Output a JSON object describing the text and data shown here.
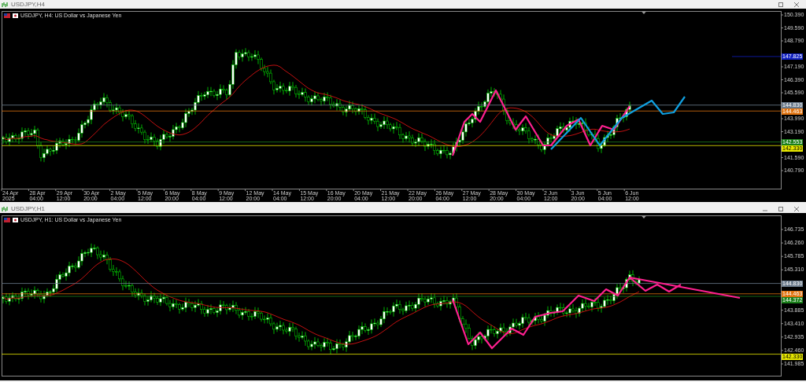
{
  "windows": [
    {
      "title": "USDJPY,H4",
      "header": "USDJPY, H4: US Dollar vs Japanese Yen",
      "price_labels": [
        "150.390",
        "149.590",
        "148.790",
        "147.190",
        "146.390",
        "145.590",
        "143.990",
        "143.190",
        "141.590",
        "140.790"
      ],
      "level_labels": [
        {
          "text": "147.825",
          "color": "#1020c0"
        },
        {
          "text": "144.830",
          "color": "#6b7b8c"
        },
        {
          "text": "144.463",
          "color": "#e0720e"
        },
        {
          "text": "142.553",
          "color": "#1a7f1a"
        },
        {
          "text": "142.330",
          "color": "#e8e800"
        }
      ],
      "time_labels": [
        "24 Apr 2025",
        "28 Apr 04:00",
        "29 Apr 12:00",
        "30 Apr 20:00",
        "2 May 04:00",
        "5 May 12:00",
        "6 May 20:00",
        "8 May 04:00",
        "9 May 12:00",
        "12 May 20:00",
        "14 May 04:00",
        "15 May 12:00",
        "16 May 20:00",
        "20 May 04:00",
        "21 May 12:00",
        "22 May 20:00",
        "26 May 04:00",
        "27 May 12:00",
        "28 May 20:00",
        "30 May 04:00",
        "2 Jun 12:00",
        "3 Jun 20:00",
        "5 Jun 04:00",
        "6 Jun 12:00"
      ]
    },
    {
      "title": "USDJPY,H1",
      "header": "USDJPY, H1: US Dollar vs Japanese Yen",
      "price_labels": [
        "146.735",
        "146.260",
        "145.785",
        "145.310",
        "143.885",
        "143.410",
        "142.935",
        "142.460",
        "141.985"
      ],
      "level_labels": [
        {
          "text": "144.830",
          "color": "#6b7b8c"
        },
        {
          "text": "144.463",
          "color": "#e0720e"
        },
        {
          "text": "144.372",
          "color": "#1a7f1a"
        },
        {
          "text": "142.330",
          "color": "#e8e800"
        }
      ]
    }
  ]
}
